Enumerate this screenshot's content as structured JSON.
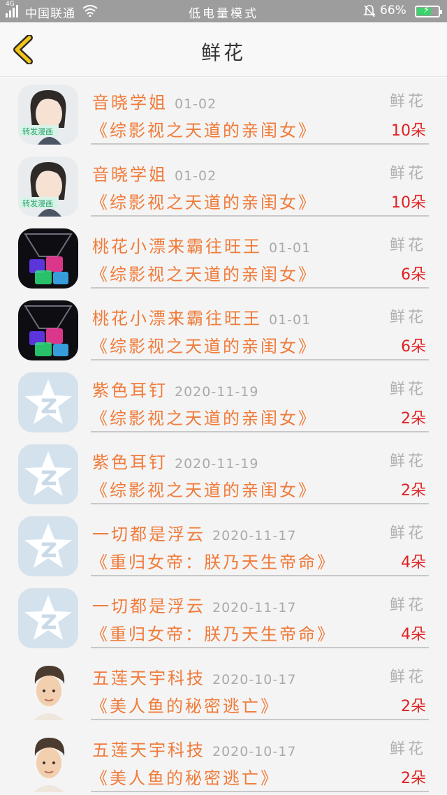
{
  "status_bar": {
    "network": "4G",
    "carrier": "中国联通",
    "mode": "低电量模式",
    "battery": "66%",
    "battery_level": 0.66,
    "icons": [
      "signal-icon",
      "wifi-icon",
      "mute-bell-icon",
      "battery-charging-icon"
    ]
  },
  "header": {
    "title": "鲜花",
    "back_icon": "chevron-left-icon"
  },
  "records": [
    {
      "name": "音晓学姐",
      "date": "01-02",
      "kind": "鲜花",
      "book": "《综影视之天道的亲闺女》",
      "count": "10朵",
      "avatar": "anime-girl"
    },
    {
      "name": "音晓学姐",
      "date": "01-02",
      "kind": "鲜花",
      "book": "《综影视之天道的亲闺女》",
      "count": "10朵",
      "avatar": "anime-girl"
    },
    {
      "name": "桃花小漂来霸往旺王",
      "date": "01-01",
      "kind": "鲜花",
      "book": "《综影视之天道的亲闺女》",
      "count": "6朵",
      "avatar": "glowing-cubes"
    },
    {
      "name": "桃花小漂来霸往旺王",
      "date": "01-01",
      "kind": "鲜花",
      "book": "《综影视之天道的亲闺女》",
      "count": "6朵",
      "avatar": "glowing-cubes"
    },
    {
      "name": "紫色耳钉",
      "date": "2020-11-19",
      "kind": "鲜花",
      "book": "《综影视之天道的亲闺女》",
      "count": "2朵",
      "avatar": "qq-star"
    },
    {
      "name": "紫色耳钉",
      "date": "2020-11-19",
      "kind": "鲜花",
      "book": "《综影视之天道的亲闺女》",
      "count": "2朵",
      "avatar": "qq-star"
    },
    {
      "name": "一切都是浮云",
      "date": "2020-11-17",
      "kind": "鲜花",
      "book": "《重归女帝：朕乃天生帝命》",
      "count": "4朵",
      "avatar": "qq-star"
    },
    {
      "name": "一切都是浮云",
      "date": "2020-11-17",
      "kind": "鲜花",
      "book": "《重归女帝：朕乃天生帝命》",
      "count": "4朵",
      "avatar": "qq-star"
    },
    {
      "name": "五莲天宇科技",
      "date": "2020-10-17",
      "kind": "鲜花",
      "book": "《美人鱼的秘密逃亡》",
      "count": "2朵",
      "avatar": "cartoon-boy"
    },
    {
      "name": "五莲天宇科技",
      "date": "2020-10-17",
      "kind": "鲜花",
      "book": "《美人鱼的秘密逃亡》",
      "count": "2朵",
      "avatar": "cartoon-boy"
    }
  ]
}
